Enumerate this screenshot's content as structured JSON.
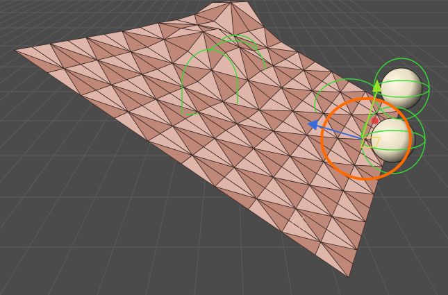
{
  "scene": {
    "view": "scene-view",
    "grid_color": "#5c5c5c",
    "background_color": "#4b4b4b",
    "mesh": {
      "name": "cloth-mesh",
      "cols": 12,
      "rows": 10,
      "light_color": "#e0b5aa",
      "dark_color": "#c08878",
      "edge_color": "#3a2a26"
    },
    "colliders": [
      {
        "name": "sphere-collider-front",
        "selected": true
      },
      {
        "name": "sphere-collider-back",
        "selected": false
      }
    ],
    "gizmo_colors": {
      "selection": "#ff6a00",
      "collider": "#33dd33",
      "axis_x": "#dd3333",
      "axis_y": "#9be02a",
      "axis_z": "#3a6bd9"
    },
    "icons": [
      "sun-light-icon",
      "move-tool-gizmo"
    ]
  }
}
